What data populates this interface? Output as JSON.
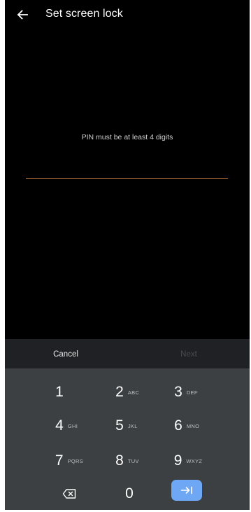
{
  "header": {
    "title": "Set screen lock"
  },
  "main": {
    "hint": "PIN must be at least 4 digits",
    "pin_value": ""
  },
  "actions": {
    "cancel_label": "Cancel",
    "next_label": "Next"
  },
  "keypad": {
    "keys": [
      {
        "digit": "1",
        "letters": ""
      },
      {
        "digit": "2",
        "letters": "ABC"
      },
      {
        "digit": "3",
        "letters": "DEF"
      },
      {
        "digit": "4",
        "letters": "GHI"
      },
      {
        "digit": "5",
        "letters": "JKL"
      },
      {
        "digit": "6",
        "letters": "MNO"
      },
      {
        "digit": "7",
        "letters": "PQRS"
      },
      {
        "digit": "8",
        "letters": "TUV"
      },
      {
        "digit": "9",
        "letters": "WXYZ"
      },
      {
        "digit": "0",
        "letters": ""
      }
    ],
    "backspace_icon": "backspace-icon",
    "enter_icon": "enter-arrow-icon"
  },
  "colors": {
    "background": "#000000",
    "accent_underline": "#b5743f",
    "keypad_bg": "#3c4043",
    "enter_key": "#6ea7f3",
    "disabled_text": "#4a4a4d"
  }
}
